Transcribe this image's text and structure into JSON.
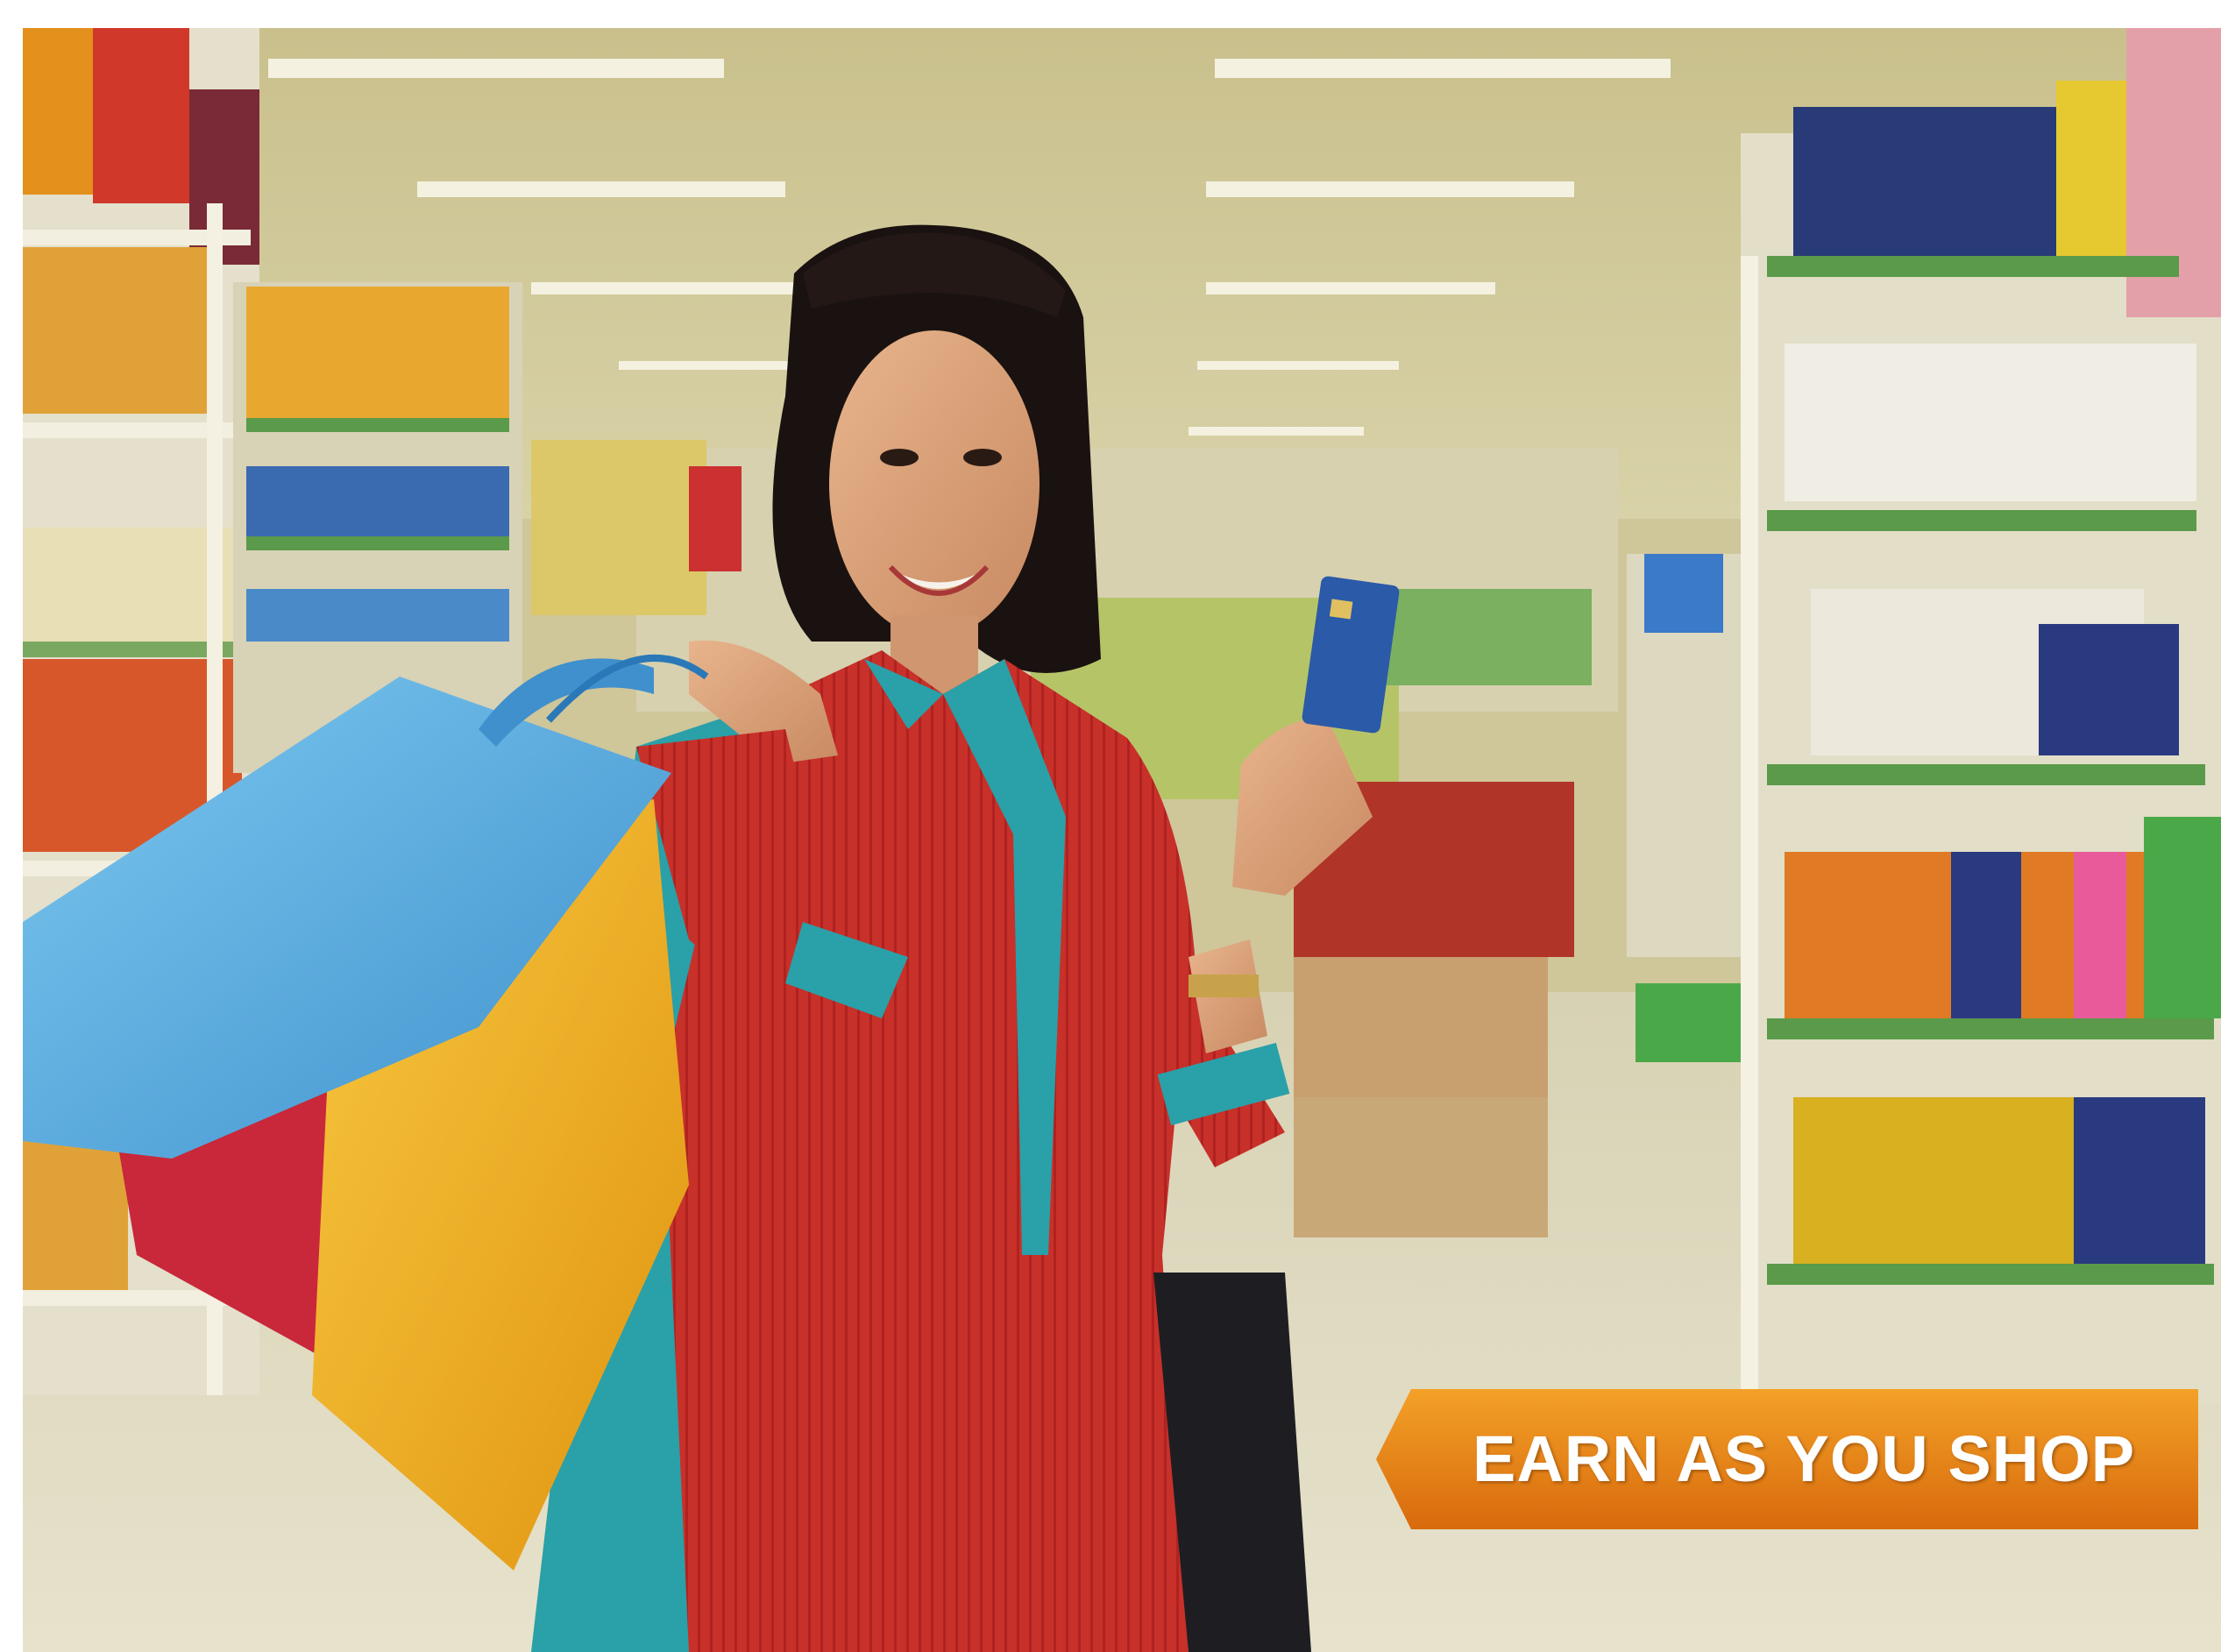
{
  "banner": {
    "text": "EARN AS YOU SHOP",
    "color_top": "#f3a128",
    "color_bottom": "#d86a0c"
  },
  "scene": {
    "setting": "supermarket-aisle",
    "subject": "woman-with-shopping-bags-and-card"
  },
  "colors": {
    "kurta": "#c8302a",
    "dupatta": "#2aa0a8",
    "bag_blue": "#5fb0e0",
    "bag_red": "#c8283a",
    "bag_yellow": "#f0b020",
    "card": "#2a5aa8",
    "shelf_green": "#5a9a4a"
  }
}
